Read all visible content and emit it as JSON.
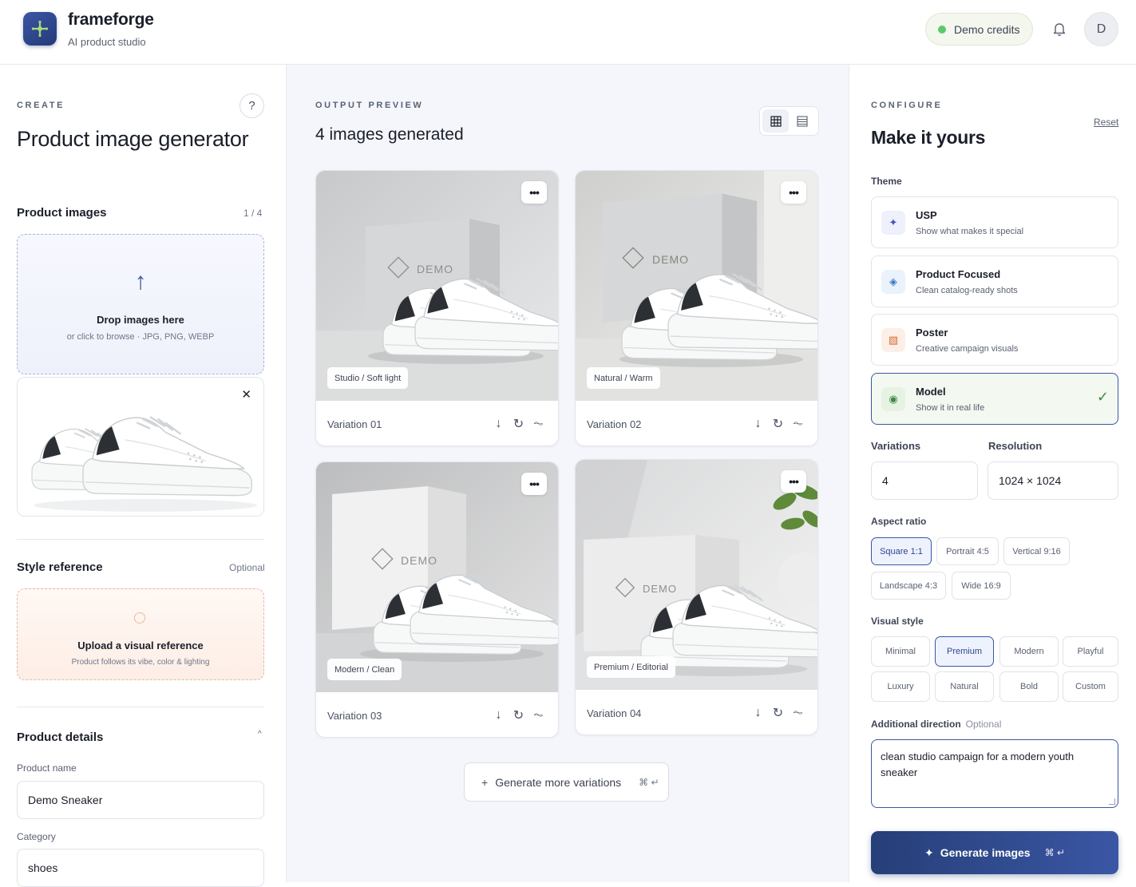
{
  "header": {
    "brand_name": "frameforge",
    "brand_sub": "AI product studio",
    "credits": "Demo credits",
    "avatar_initial": "D"
  },
  "left": {
    "eyebrow": "CREATE",
    "help": "?",
    "title": "Product image generator",
    "product_images": {
      "title": "Product images",
      "count": "1 / 4"
    },
    "dropzone": {
      "title": "Drop images here",
      "sub": "or click to browse · JPG, PNG, WEBP"
    },
    "style_ref": {
      "title": "Style reference",
      "optional": "Optional",
      "upload_title": "Upload a visual reference",
      "upload_sub": "Product follows its vibe, color & lighting"
    },
    "details": {
      "title": "Product details",
      "name_label": "Product name",
      "name_value": "Demo Sneaker",
      "category_label": "Category",
      "category_value": "shoes"
    }
  },
  "mid": {
    "eyebrow": "OUTPUT PREVIEW",
    "title": "4 images generated",
    "cards": [
      {
        "name": "Variation 01",
        "tag": "Studio / Soft light",
        "brand": "DEMO"
      },
      {
        "name": "Variation 02",
        "tag": "Natural / Warm",
        "brand": "DEMO"
      },
      {
        "name": "Variation 03",
        "tag": "Modern / Clean",
        "brand": "DEMO"
      },
      {
        "name": "Variation 04",
        "tag": "Premium / Editorial",
        "brand": "DEMO"
      }
    ],
    "more_label": "•••",
    "generate_more": "Generate more variations",
    "generate_more_kbd": "⌘ ↵"
  },
  "right": {
    "eyebrow": "CONFIGURE",
    "reset": "Reset",
    "title": "Make it yours",
    "theme_label": "Theme",
    "themes": [
      {
        "title": "USP",
        "sub": "Show what makes it special"
      },
      {
        "title": "Product Focused",
        "sub": "Clean catalog-ready shots"
      },
      {
        "title": "Poster",
        "sub": "Creative campaign visuals"
      },
      {
        "title": "Model",
        "sub": "Show it in real life"
      }
    ],
    "variations_label": "Variations",
    "variations_value": "4",
    "resolution_label": "Resolution",
    "resolution_value": "1024 × 1024",
    "aspect_label": "Aspect ratio",
    "aspects": [
      "Square 1:1",
      "Portrait 4:5",
      "Vertical 9:16",
      "Landscape 4:3",
      "Wide 16:9"
    ],
    "visual_label": "Visual style",
    "styles": [
      "Minimal",
      "Premium",
      "Modern",
      "Playful",
      "Luxury",
      "Natural",
      "Bold",
      "Custom"
    ],
    "direction_label": "Additional direction",
    "direction_optional": "Optional",
    "direction_value": "clean studio campaign for a modern youth sneaker",
    "generate": "Generate images",
    "generate_kbd": "⌘ ↵"
  },
  "colors": {
    "accent": "#3b56a4",
    "accent_dark": "#263f78",
    "success": "#5dc96a",
    "canvas": "#f4f6fb"
  }
}
